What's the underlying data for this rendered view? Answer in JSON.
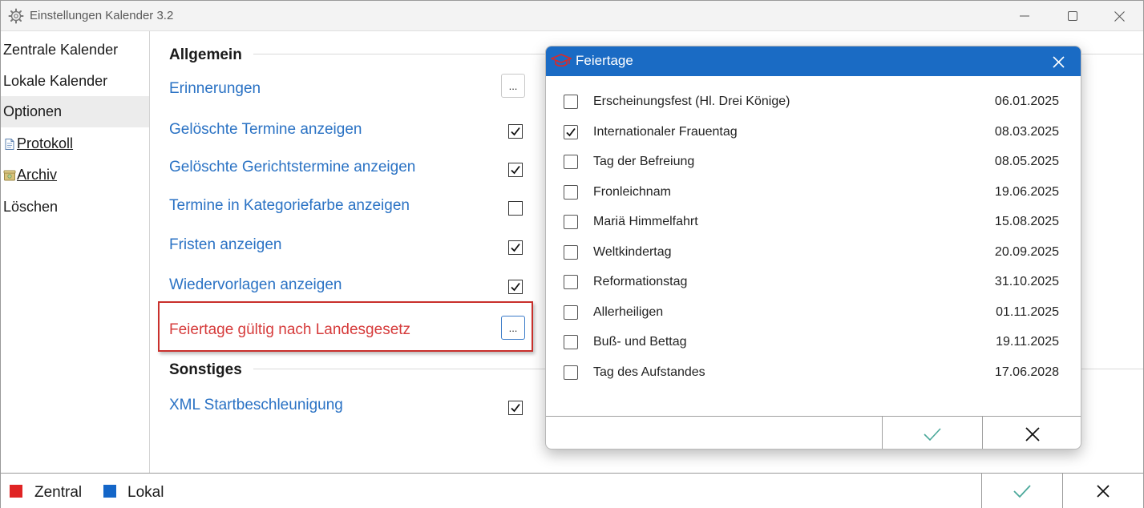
{
  "window": {
    "title": "Einstellungen Kalender 3.2",
    "icon": "gear-icon"
  },
  "sidebar": {
    "items": [
      {
        "label": "Zentrale Kalender",
        "selected": false
      },
      {
        "label": "Lokale Kalender",
        "selected": false
      },
      {
        "label": "Optionen",
        "selected": true
      },
      {
        "label": "Protokoll",
        "icon": "document-icon",
        "link": true
      },
      {
        "label": "Archiv",
        "icon": "archive-icon",
        "link": true
      },
      {
        "label": "Löschen",
        "selected": false
      }
    ]
  },
  "main": {
    "section_general": "Allgemein",
    "section_other": "Sonstiges",
    "options": [
      {
        "label": "Erinnerungen",
        "control": "button",
        "button_label": "..."
      },
      {
        "label": "Gelöschte Termine anzeigen",
        "control": "checkbox",
        "checked": true
      },
      {
        "label": "Gelöschte Gerichtstermine anzeigen",
        "control": "checkbox",
        "checked": true
      },
      {
        "label": "Termine in Kategoriefarbe anzeigen",
        "control": "checkbox",
        "checked": false
      },
      {
        "label": "Fristen anzeigen",
        "control": "checkbox",
        "checked": true
      },
      {
        "label": "Wiedervorlagen anzeigen",
        "control": "checkbox",
        "checked": true
      },
      {
        "label": "Feiertage gültig nach Landesgesetz",
        "control": "button",
        "button_label": "...",
        "highlighted": true
      },
      {
        "label": "XML Startbeschleunigung",
        "control": "checkbox",
        "checked": true
      }
    ]
  },
  "footer": {
    "legend": [
      {
        "label": "Zentral",
        "color": "#e02424"
      },
      {
        "label": "Lokal",
        "color": "#1466c8"
      }
    ],
    "ok_icon": "check-icon",
    "cancel_icon": "close-icon"
  },
  "dialog": {
    "title": "Feiertage",
    "title_color": "#1a6bc4",
    "icon": "graduation-cap-icon",
    "holidays": [
      {
        "name": "Erscheinungsfest (Hl. Drei Könige)",
        "date": "06.01.2025",
        "checked": false
      },
      {
        "name": "Internationaler Frauentag",
        "date": "08.03.2025",
        "checked": true
      },
      {
        "name": "Tag der Befreiung",
        "date": "08.05.2025",
        "checked": false
      },
      {
        "name": "Fronleichnam",
        "date": "19.06.2025",
        "checked": false
      },
      {
        "name": "Mariä Himmelfahrt",
        "date": "15.08.2025",
        "checked": false
      },
      {
        "name": "Weltkindertag",
        "date": "20.09.2025",
        "checked": false
      },
      {
        "name": "Reformationstag",
        "date": "31.10.2025",
        "checked": false
      },
      {
        "name": "Allerheiligen",
        "date": "01.11.2025",
        "checked": false
      },
      {
        "name": "Buß- und Bettag",
        "date": "19.11.2025",
        "checked": false
      },
      {
        "name": "Tag des Aufstandes",
        "date": "17.06.2028",
        "checked": false
      }
    ]
  }
}
